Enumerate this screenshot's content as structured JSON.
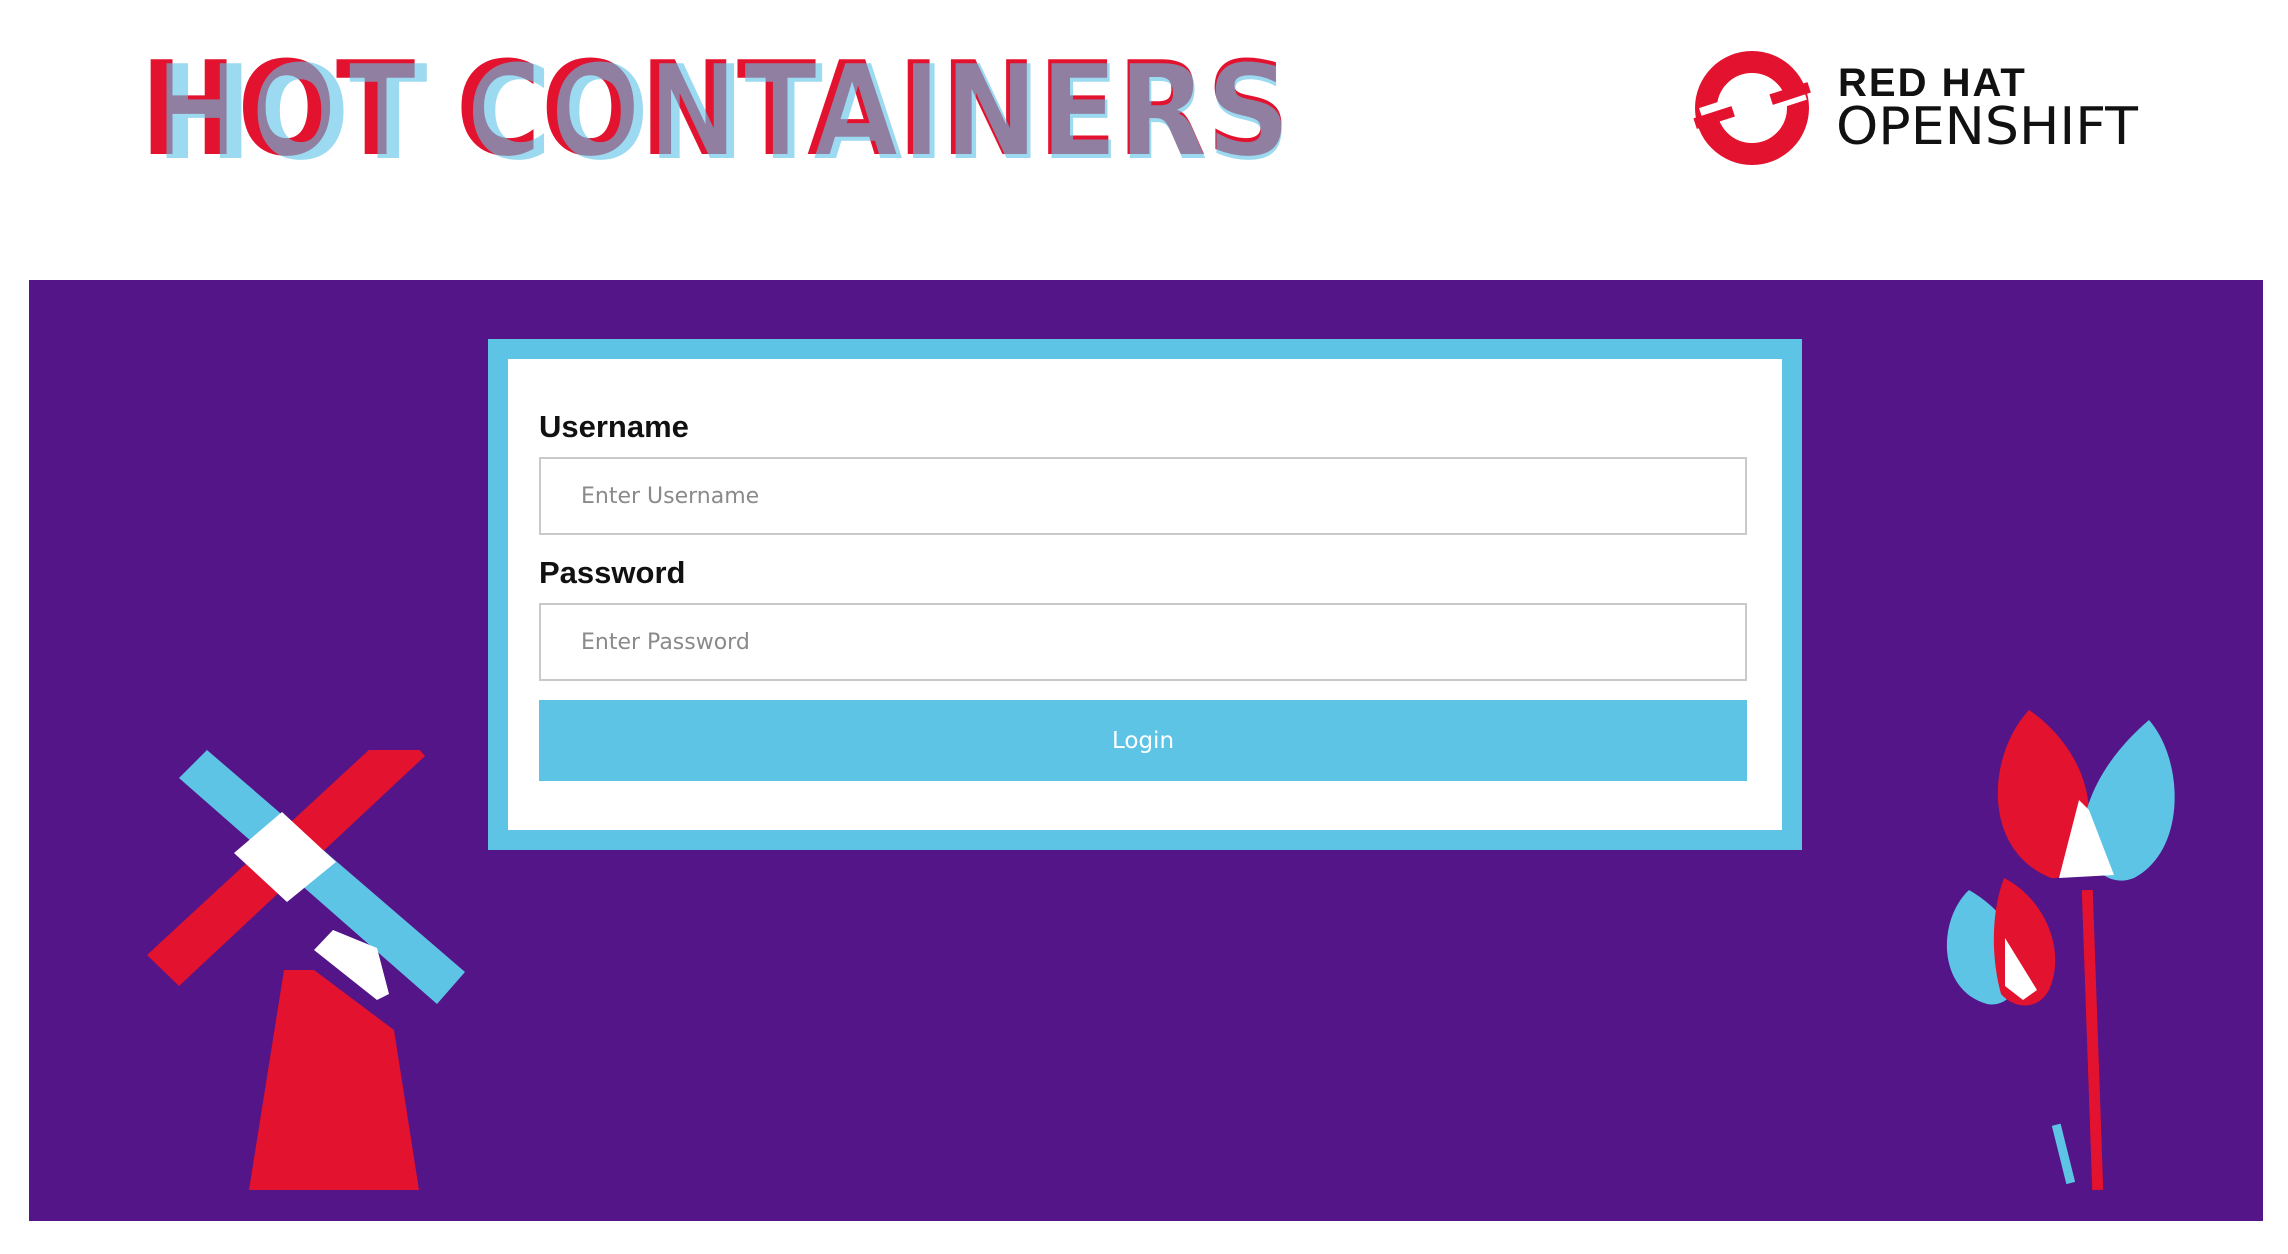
{
  "header": {
    "title": "HOT CONTAINERS",
    "partner_logo": {
      "line1": "RED HAT",
      "line2": "OPENSHIFT"
    }
  },
  "login": {
    "username": {
      "label": "Username",
      "value": "",
      "placeholder": "Enter Username"
    },
    "password": {
      "label": "Password",
      "value": "",
      "placeholder": "Enter Password"
    },
    "submit_label": "Login"
  },
  "decor": {
    "left_icon": "windmill-icon",
    "right_icon": "tulips-icon"
  },
  "colors": {
    "brand_red": "#e3122f",
    "brand_blue": "#5ec4e6",
    "stage_purple": "#531587",
    "overlap_purple": "#7c3b9c"
  }
}
